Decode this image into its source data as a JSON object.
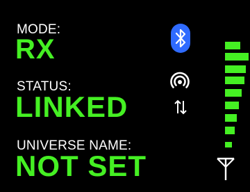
{
  "screen": {
    "mode": {
      "label": "MODE:",
      "value": "RX"
    },
    "status": {
      "label": "STATUS:",
      "value": "LINKED"
    },
    "universe": {
      "label": "UNIVERSE NAME:",
      "value": "NOT SET"
    }
  },
  "icons": {
    "bluetooth": "bluetooth-icon",
    "broadcast": "broadcast-icon",
    "transfer": "transfer-arrows-icon",
    "antenna": "antenna-icon"
  },
  "signal": {
    "level": 1.0,
    "bars_lit": 9,
    "bars_total": 9
  },
  "colors": {
    "background": "#000000",
    "label": "#FFFFFF",
    "value": "#45F023",
    "signal": "#45F023",
    "bluetooth_bg": "#2F6BFF"
  }
}
